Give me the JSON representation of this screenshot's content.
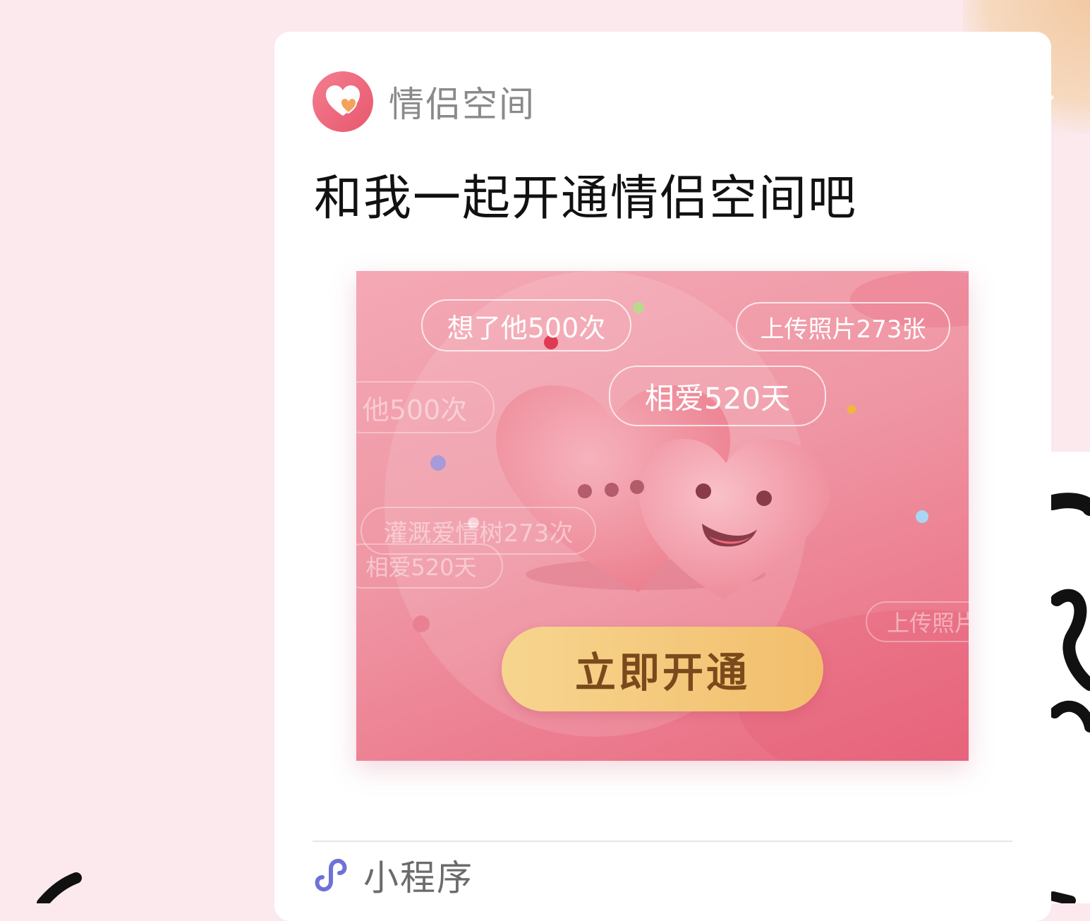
{
  "app": {
    "name": "情侣空间"
  },
  "share": {
    "title": "和我一起开通情侣空间吧"
  },
  "preview": {
    "bubbles": [
      "想了他500次",
      "上传照片273张",
      "相爱520天",
      "他500次",
      "灌溉爱情树273次",
      "相爱520天",
      "上传照片"
    ],
    "cta_label": "立即开通"
  },
  "footer": {
    "label": "小程序"
  },
  "colors": {
    "accent": "#e8586e",
    "preview_gradient_start": "#f4a9b5",
    "preview_gradient_end": "#e9687f",
    "cta_gold": "#f2be6c"
  },
  "icons": {
    "app_logo": "heart-logo-icon",
    "mini_program": "mini-program-icon"
  }
}
